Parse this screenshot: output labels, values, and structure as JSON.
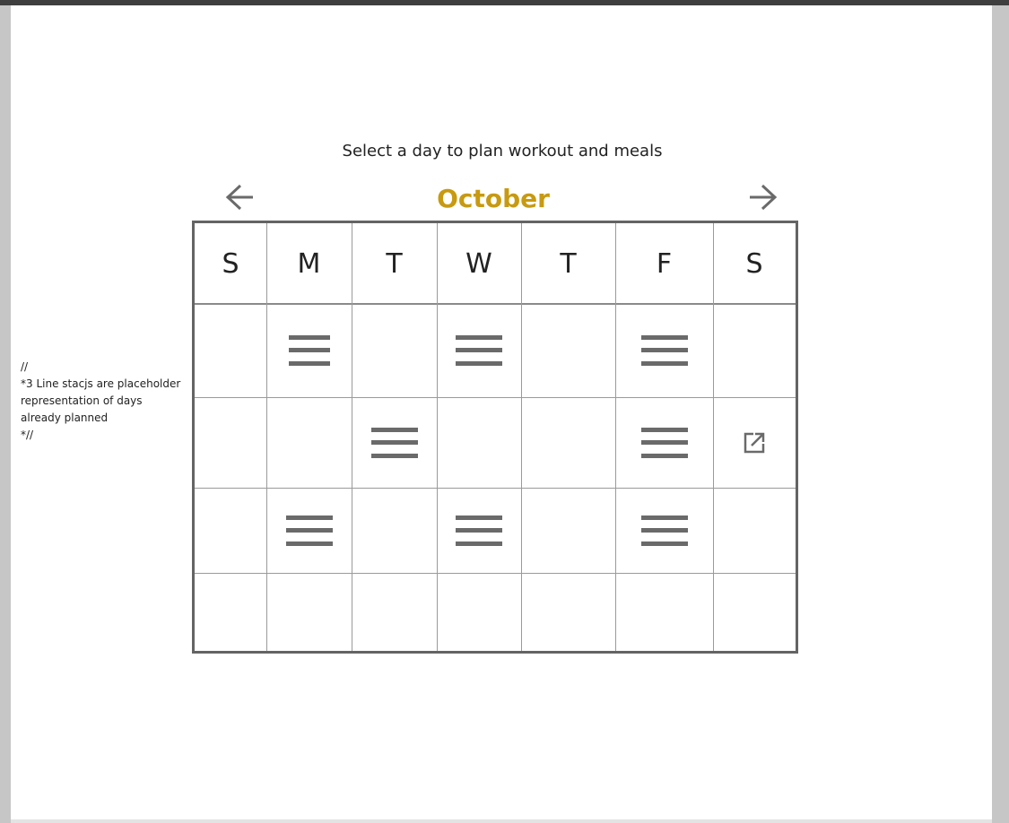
{
  "header": {
    "instruction": "Select a day to plan workout and meals",
    "month": "October",
    "prev_icon": "arrow-left-icon",
    "next_icon": "arrow-right-icon"
  },
  "calendar": {
    "weekdays": [
      "S",
      "M",
      "T",
      "W",
      "T",
      "F",
      "S"
    ],
    "weeks": [
      [
        "",
        "planned",
        "",
        "planned",
        "",
        "planned",
        ""
      ],
      [
        "",
        "",
        "planned",
        "",
        "",
        "planned",
        "open"
      ],
      [
        "",
        "planned",
        "",
        "planned",
        "",
        "planned",
        ""
      ],
      [
        "",
        "",
        "",
        "",
        "",
        "",
        ""
      ]
    ],
    "planned_icon": "three-line-stack-icon",
    "open_icon": "external-link-icon"
  },
  "note": {
    "text": "//\n*3 Line stacjs are placeholder representation of days already planned\n*//"
  },
  "colors": {
    "accent": "#c89a10",
    "border": "#646464",
    "icon": "#6a6a6a",
    "text": "#222222"
  }
}
